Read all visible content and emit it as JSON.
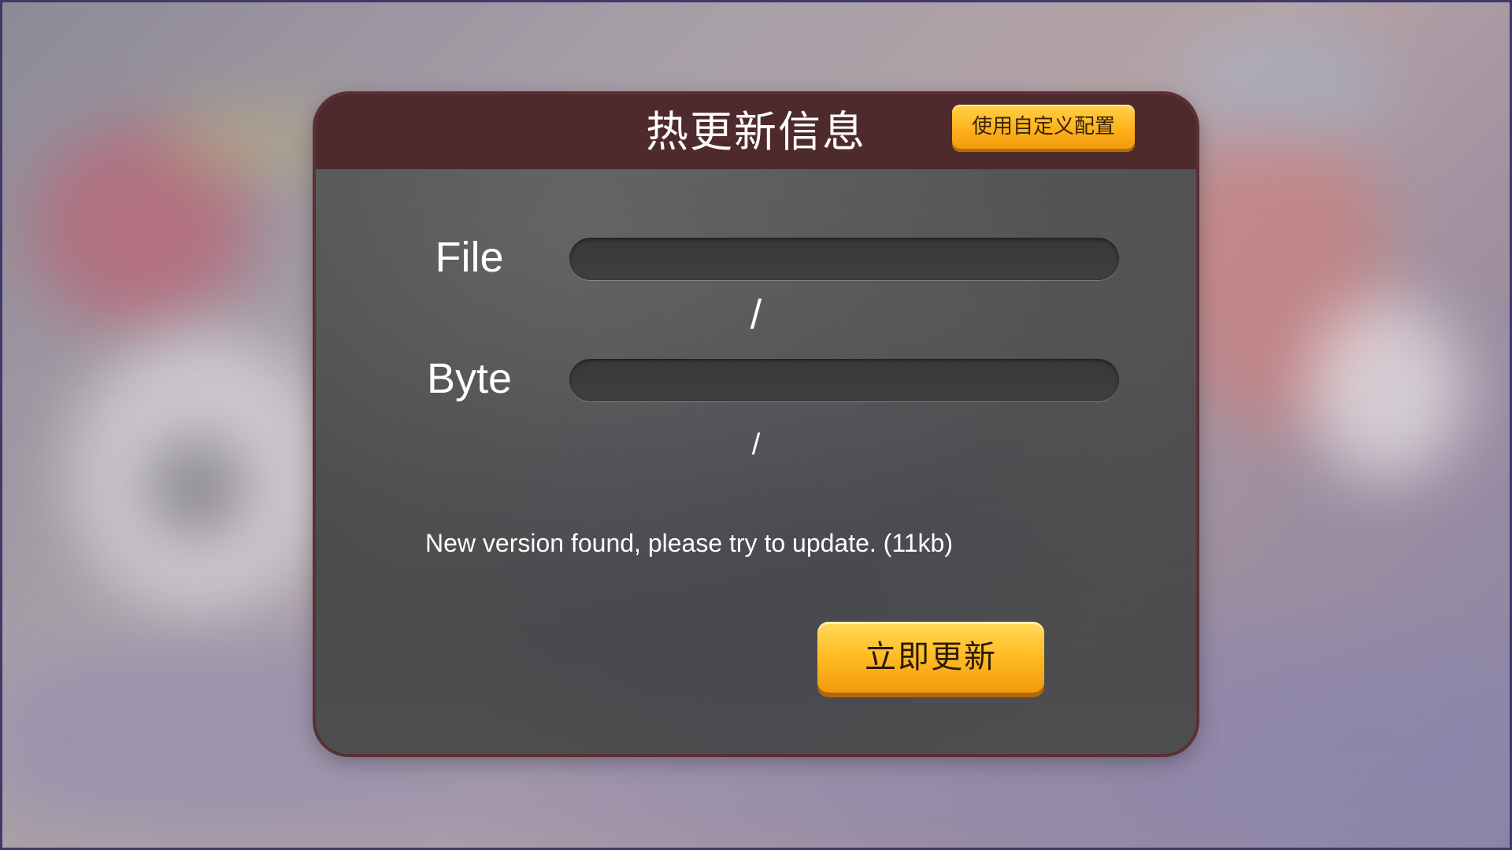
{
  "dialog": {
    "title": "热更新信息",
    "custom_config_label": "使用自定义配置",
    "file_label": "File",
    "byte_label": "Byte",
    "file_count_text": "/",
    "byte_count_text": "/",
    "file_progress": 0,
    "byte_progress": 0,
    "status_message": "New version found, please try to update. (11kb)",
    "update_button_label": "立即更新"
  },
  "colors": {
    "header": "#4f2a2c",
    "dialog_border": "#5a2f35",
    "button_orange": "#ffb21c"
  }
}
